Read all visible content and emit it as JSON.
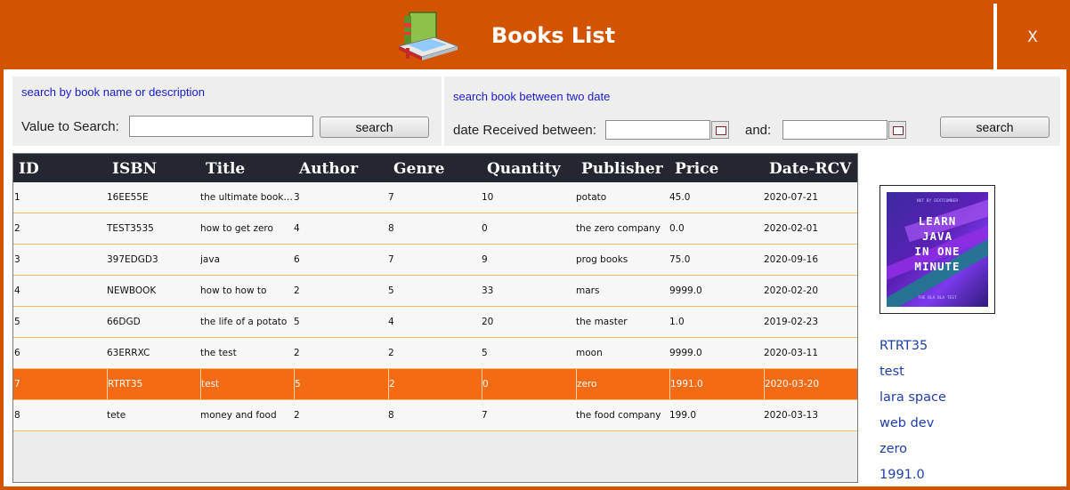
{
  "window": {
    "title": "Books List",
    "close_label": "X",
    "accent_color": "#d35400",
    "selected_row_color": "#f56b13"
  },
  "search_by_name": {
    "title": "search by book name or description",
    "value_label": "Value to Search:",
    "value": "",
    "button_label": "search"
  },
  "search_by_date": {
    "title": "search book between two date",
    "date_label": "date Received between:",
    "from_value": "",
    "and_label": "and:",
    "to_value": "",
    "button_label": "search"
  },
  "table": {
    "columns": [
      "ID",
      "ISBN",
      "Title",
      "Author",
      "Genre",
      "Quantity",
      "Publisher",
      "Price",
      "Date-RCV"
    ],
    "rows": [
      [
        "1",
        "16EE55E",
        "the ultimate book ...",
        "3",
        "7",
        "10",
        "potato",
        "45.0",
        "2020-07-21"
      ],
      [
        "2",
        "TEST3535",
        "how to get zero",
        "4",
        "8",
        "0",
        "the zero company",
        "0.0",
        "2020-02-01"
      ],
      [
        "3",
        "397EDGD3",
        "java",
        "6",
        "7",
        "9",
        "prog books",
        "75.0",
        "2020-09-16"
      ],
      [
        "4",
        "NEWBOOK",
        "how to how to",
        "2",
        "5",
        "33",
        "mars",
        "9999.0",
        "2020-02-20"
      ],
      [
        "5",
        "66DGD",
        "the life of a potato",
        "5",
        "4",
        "20",
        "the master",
        "1.0",
        "2019-02-23"
      ],
      [
        "6",
        "63ERRXC",
        "the test",
        "2",
        "2",
        "5",
        "moon",
        "9999.0",
        "2020-03-11"
      ],
      [
        "7",
        "RTRT35",
        "test",
        "5",
        "2",
        "0",
        "zero",
        "1991.0",
        "2020-03-20"
      ],
      [
        "8",
        "tete",
        "money and food",
        "2",
        "8",
        "7",
        "the food company",
        "199.0",
        "2020-03-13"
      ]
    ],
    "selected_row": 6
  },
  "details": {
    "cover_lines": "LEARN\nJAVA\nIN ONE\nMINUTE",
    "cover_top_text": "NOT BY SEXTCOMBER",
    "cover_bottom_text": "THE BLA BLA TEST",
    "isbn": "RTRT35",
    "title": "test",
    "author": "lara space",
    "genre": "web dev",
    "publisher": "zero",
    "price": "1991.0"
  }
}
